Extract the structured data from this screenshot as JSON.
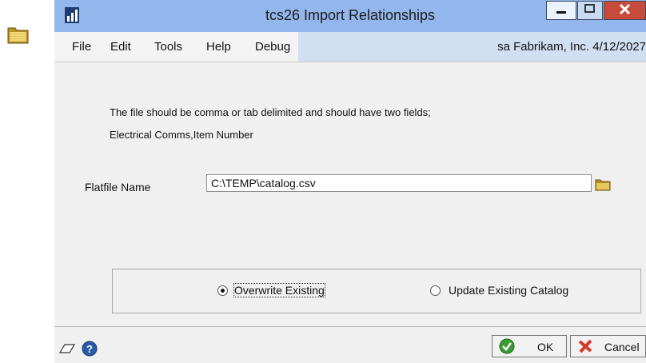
{
  "window": {
    "title": "tcs26 Import Relationships"
  },
  "menu": {
    "items": [
      "File",
      "Edit",
      "Tools",
      "Help",
      "Debug"
    ],
    "info": "sa  Fabrikam, Inc. 4/12/2027"
  },
  "instructions": {
    "line1": "The file should be comma or tab delimited and should have  two fields;",
    "line2": "Electrical Comms,Item Number"
  },
  "flatfile": {
    "label": "Flatfile Name",
    "value": "C:\\TEMP\\catalog.csv"
  },
  "options": {
    "overwrite": {
      "label": "Overwrite Existing",
      "selected": true
    },
    "update": {
      "label": "Update Existing Catalog",
      "selected": false
    }
  },
  "buttons": {
    "ok": "OK",
    "cancel": "Cancel"
  },
  "colors": {
    "titlebar": "#93b7ec",
    "info_bar": "#d1dff3",
    "close_button": "#c74a3a"
  }
}
